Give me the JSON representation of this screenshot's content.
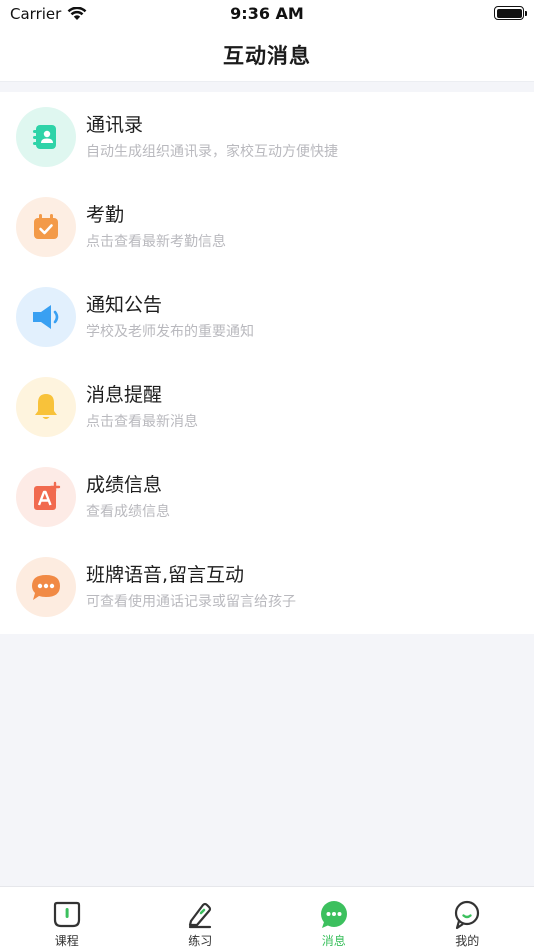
{
  "status_bar": {
    "carrier": "Carrier",
    "time": "9:36 AM"
  },
  "header": {
    "title": "互动消息"
  },
  "menu": [
    {
      "title": "通讯录",
      "subtitle": "自动生成组织通讯录，家校互动方便快捷",
      "icon": "contacts-icon",
      "bg": "#dff7f0",
      "fg": "#2fd3a8"
    },
    {
      "title": "考勤",
      "subtitle": "点击查看最新考勤信息",
      "icon": "calendar-check-icon",
      "bg": "#fdeee3",
      "fg": "#f39a48"
    },
    {
      "title": "通知公告",
      "subtitle": "学校及老师发布的重要通知",
      "icon": "speaker-icon",
      "bg": "#e2f0fd",
      "fg": "#39a0f2"
    },
    {
      "title": "消息提醒",
      "subtitle": "点击查看最新消息",
      "icon": "bell-icon",
      "bg": "#fef4de",
      "fg": "#f8c23a"
    },
    {
      "title": "成绩信息",
      "subtitle": "查看成绩信息",
      "icon": "grade-icon",
      "bg": "#fdebe6",
      "fg": "#f16a4f"
    },
    {
      "title": "班牌语音,留言互动",
      "subtitle": "可查看使用通话记录或留言给孩子",
      "icon": "chat-bubble-icon",
      "bg": "#fdece0",
      "fg": "#f18a45"
    }
  ],
  "tabs": [
    {
      "label": "课程",
      "icon": "course-icon",
      "active": false
    },
    {
      "label": "练习",
      "icon": "pencil-icon",
      "active": false
    },
    {
      "label": "消息",
      "icon": "message-icon",
      "active": true
    },
    {
      "label": "我的",
      "icon": "profile-icon",
      "active": false
    }
  ],
  "colors": {
    "accent": "#3cc05e",
    "background": "#f4f5f9"
  }
}
